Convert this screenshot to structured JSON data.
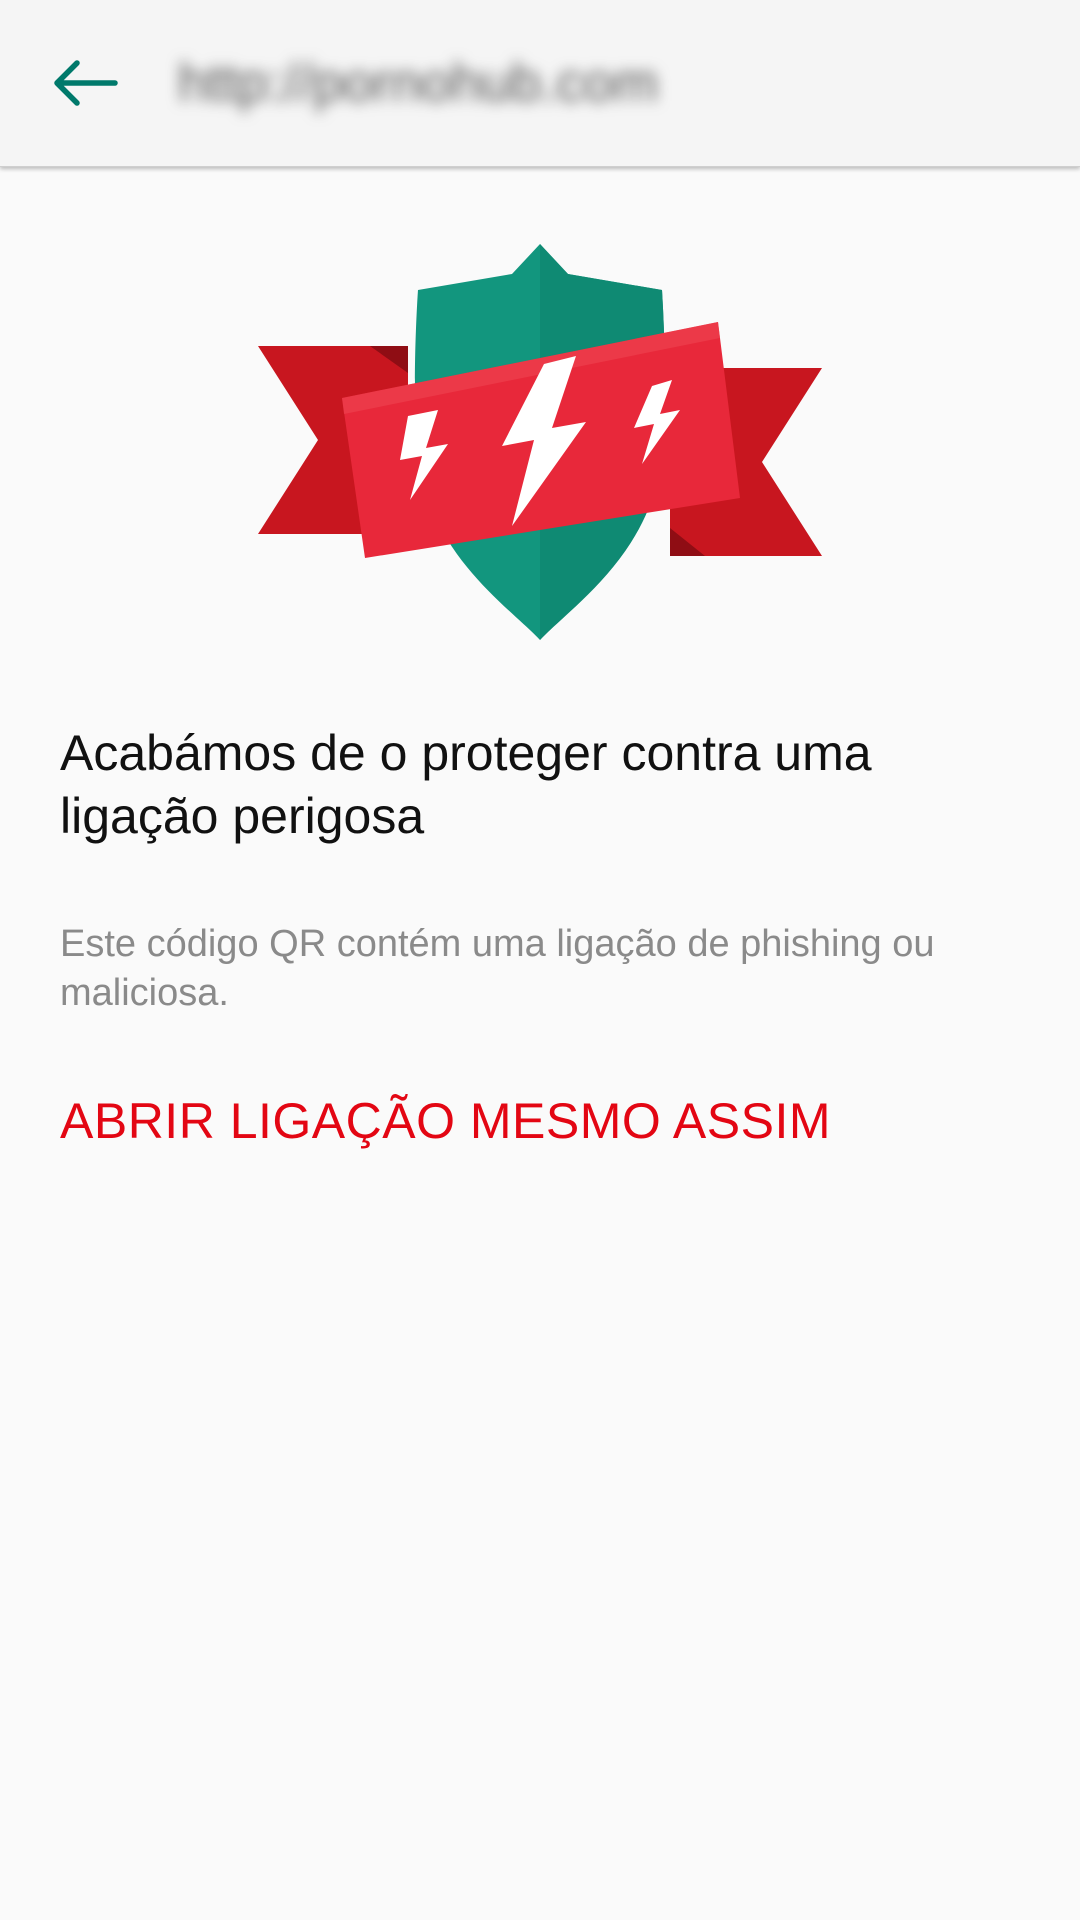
{
  "toolbar": {
    "back_icon": "arrow-left-icon",
    "url": "http://pornohub.com"
  },
  "hero": {
    "icon": "shield-ribbon-lightning-icon"
  },
  "warning": {
    "headline": "Acabámos de o proteger contra uma ligação perigosa",
    "description": "Este código QR contém uma ligação de phishing ou maliciosa.",
    "action_label": "ABRIR LIGAÇÃO MESMO ASSIM"
  },
  "colors": {
    "accent_teal": "#00796b",
    "shield_green": "#12967e",
    "ribbon_red": "#e8283a",
    "ribbon_dark_red": "#c3161f",
    "action_red": "#e30613"
  }
}
